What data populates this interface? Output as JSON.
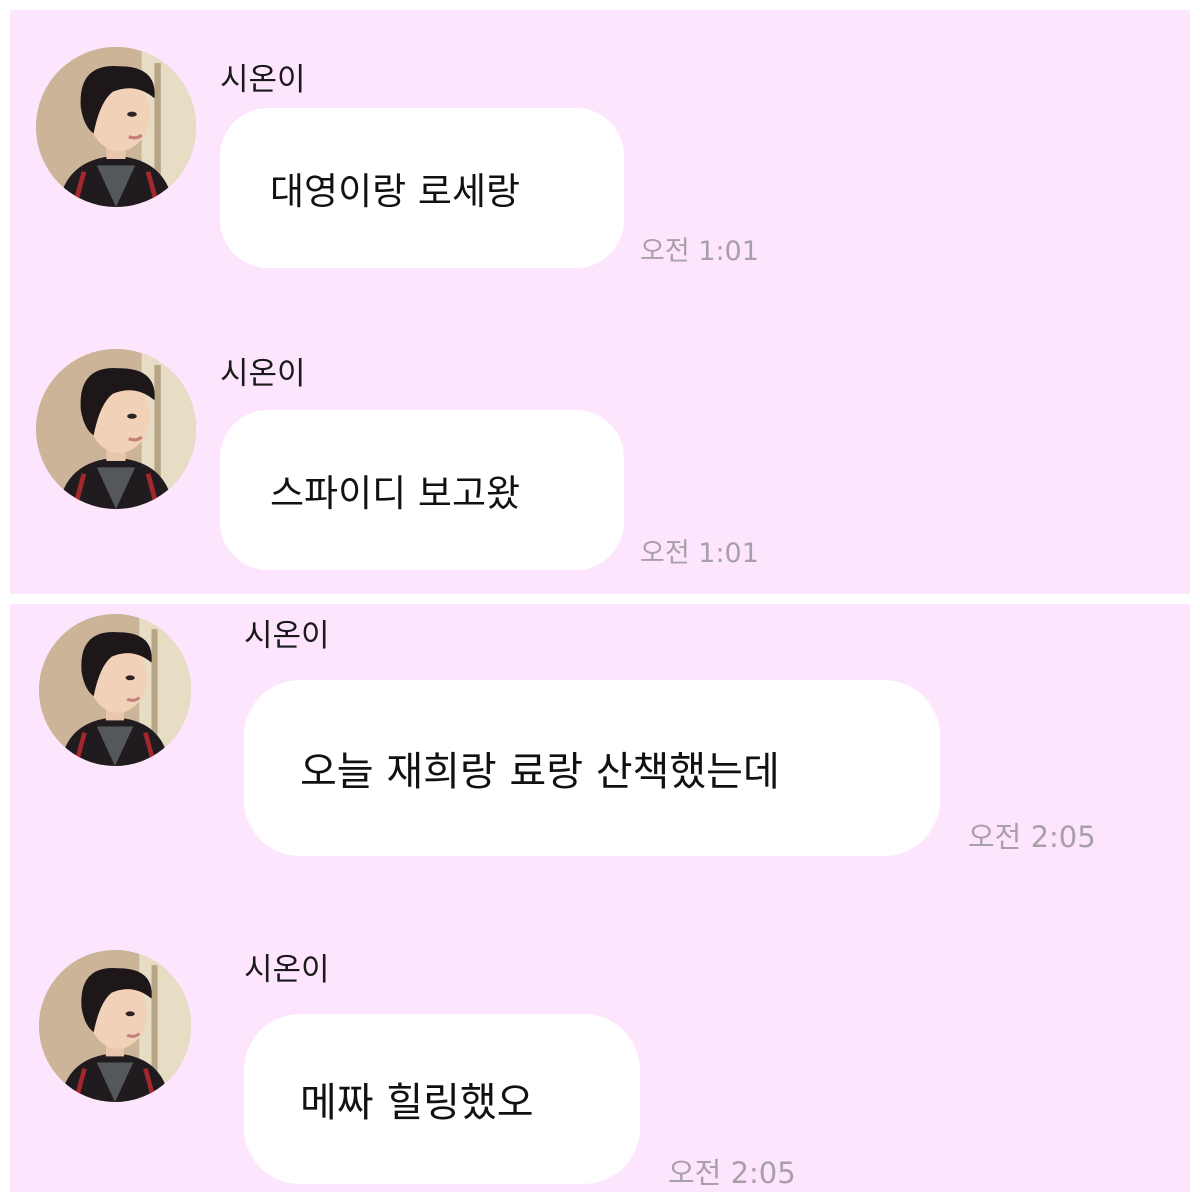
{
  "chat": {
    "messages": [
      {
        "sender": "시온이",
        "text": "대영이랑 로세랑",
        "time": "오전 1:01"
      },
      {
        "sender": "시온이",
        "text": "스파이디 보고왔",
        "time": "오전 1:01"
      },
      {
        "sender": "시온이",
        "text": "오늘 재희랑 료랑 산책했는데",
        "time": "오전 2:05"
      },
      {
        "sender": "시온이",
        "text": "메짜 힐링했오",
        "time": "오전 2:05"
      }
    ]
  },
  "colors": {
    "panel_background": "#fde6fd",
    "bubble_background": "#ffffff",
    "timestamp_text": "#a8a0a8"
  },
  "icons": {
    "avatar": "profile-photo-avatar-icon"
  }
}
